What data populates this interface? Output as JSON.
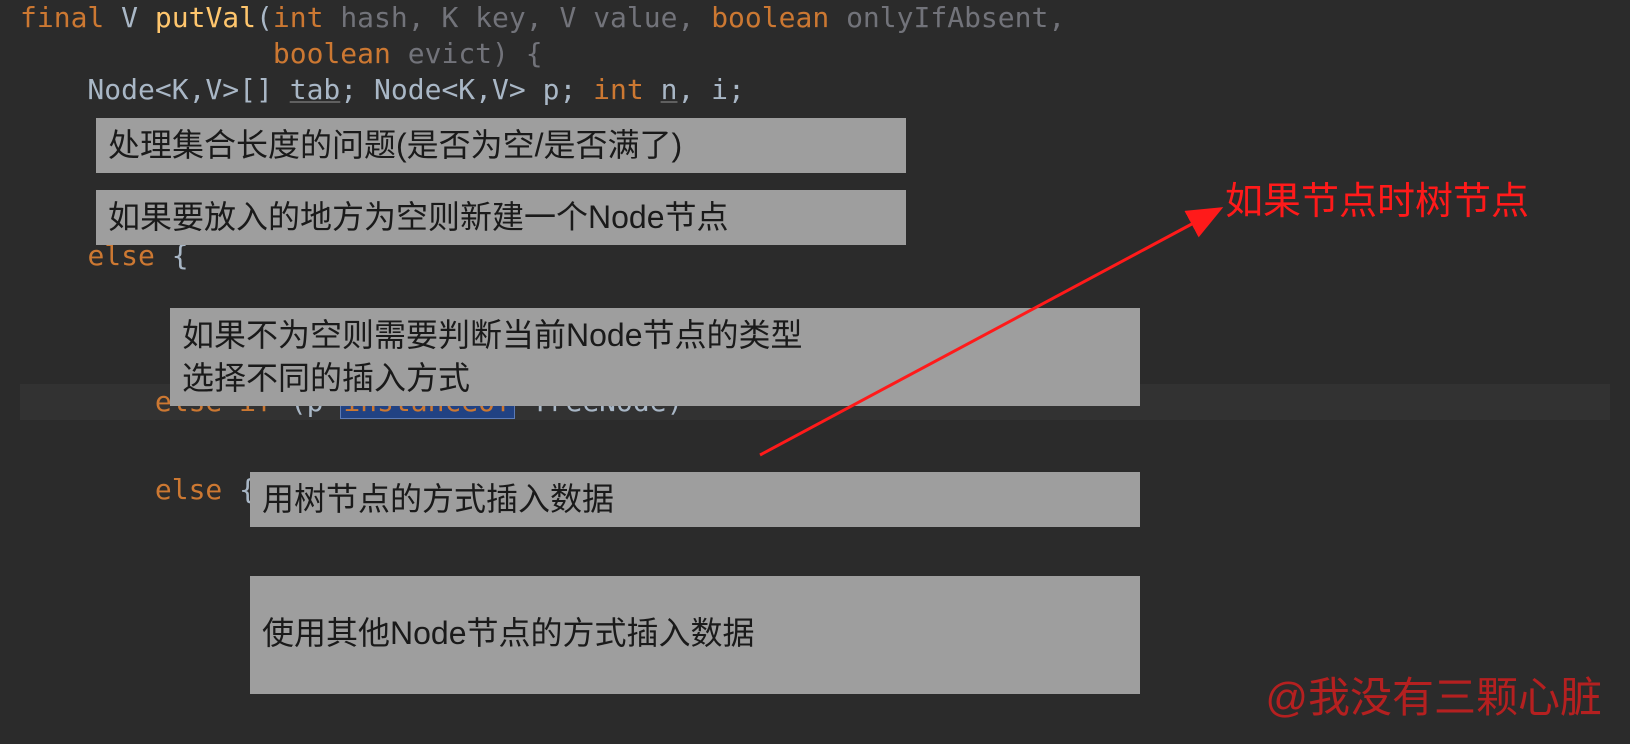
{
  "code": {
    "l1_a": "final",
    "l1_b": " V ",
    "l1_c": "putVal",
    "l1_d": "(",
    "l1_e": "int",
    "l1_f": " hash, K key, V value, ",
    "l1_g": "boolean",
    "l1_h": " onlyIfAbsent,",
    "l2_a": "               ",
    "l2_b": "boolean",
    "l2_c": " evict) {",
    "l3_a": "    Node<K,V>[] ",
    "l3_b": "tab",
    "l3_c": "; Node<K,V> p; ",
    "l3_d": "int",
    "l3_e": " ",
    "l3_f": "n",
    "l3_g": ", i;",
    "l4_a": "    ",
    "l4_b": "else",
    "l4_c": " {",
    "l5_a": "        ",
    "l5_b": "else if",
    "l5_c": " (p ",
    "l5_d": "instanceof",
    "l5_e": " TreeNode)",
    "l6_a": "        ",
    "l6_b": "else",
    "l6_c": " {"
  },
  "comment1": "处理集合长度的问题(是否为空/是否满了)",
  "comment2": "如果要放入的地方为空则新建一个Node节点",
  "comment3": "如果不为空则需要判断当前Node节点的类型\n选择不同的插入方式",
  "comment4": "用树节点的方式插入数据",
  "comment5": "使用其他Node节点的方式插入数据",
  "annotation_red": "如果节点时树节点",
  "watermark": "@我没有三颗心脏"
}
